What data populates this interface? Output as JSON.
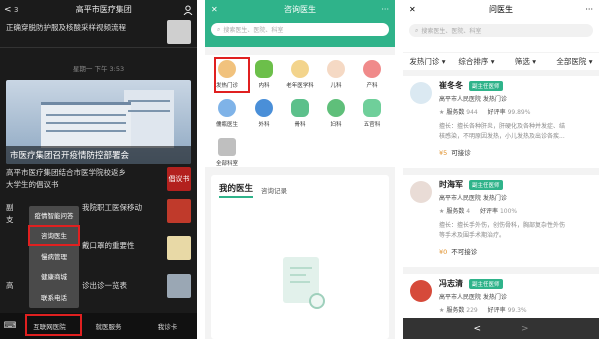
{
  "screen1": {
    "back": "<",
    "unread_badge": "3",
    "title": "高平市医疗集团",
    "feed_item_1": "正确穿脱防护服及核酸采样视频流程",
    "timestamp": "星期一 下午 3:53",
    "banner_caption": "市医疗集团召开疫情防控部署会",
    "feed_item_2_line1": "高平市医疗集团结合市医学院校返乡",
    "feed_item_2_line2": "大学生的倡议书",
    "proposal_thumb": "倡议书",
    "feed_item_3_left": "副",
    "feed_item_3_left2": "支",
    "feed_item_3": "我院职工医保移动",
    "feed_item_4": "戴口罩的重要性",
    "feed_item_5_left": "高",
    "feed_item_5": "诊出诊一览表",
    "popup_menu": [
      "疫情智能问答",
      "咨询医生",
      "慢病管理",
      "健康商城",
      "联系电话"
    ],
    "bottom_tabs": [
      "互联网医院",
      "就医服务",
      "我诊卡"
    ]
  },
  "screen2": {
    "title": "咨询医生",
    "close": "✕",
    "more": "···",
    "search_placeholder": "搜索医生、医院、科室",
    "departments": [
      "发热门诊",
      "内科",
      "老年医学科",
      "儿科",
      "产科",
      "儒瓶医生",
      "外科",
      "骨科",
      "妇科",
      "五官科",
      "全部科室"
    ],
    "tab_active": "我的医生",
    "tab_other": "咨询记录"
  },
  "screen3": {
    "title": "问医生",
    "close": "✕",
    "more": "···",
    "search_placeholder": "搜索医生、医院、科室",
    "filters": [
      "发热门诊 ▾",
      "综合排序 ▾",
      "筛选 ▾",
      "全部医院 ▾"
    ],
    "doctors": [
      {
        "name": "崔冬冬",
        "title": "副主任医师",
        "hospital": "高平市人民医院 发热门诊",
        "service_label": "服务数",
        "service_count": "944",
        "rating_label": "好评率",
        "rating": "99.89%",
        "bio1": "擅长：擅长各种肝炎，肝硬化及各种并发症、结",
        "bio2": "核感染，不明原因发热，小儿发热及出诊各疾...",
        "price": "¥5",
        "status": "可接诊"
      },
      {
        "name": "时海军",
        "title": "副主任医师",
        "hospital": "高平市人民医院 发热门诊",
        "service_label": "服务数",
        "service_count": "4",
        "rating_label": "好评率",
        "rating": "100%",
        "bio1": "擅长：擅长手外伤，创伤骨科，胸部复杂性外伤",
        "bio2": "等手术及围手术期治疗。",
        "price": "¥0",
        "status": "不可接诊"
      },
      {
        "name": "冯志清",
        "title": "副主任医师",
        "hospital": "高平市人民医院 发热门诊",
        "service_label": "服务数",
        "service_count": "229",
        "rating_label": "好评率",
        "rating": "99.3%"
      }
    ],
    "nav_prev": "<",
    "nav_next": ">"
  },
  "colors": {
    "green": "#2fb38a",
    "highlight_red": "#e02020",
    "price_orange": "#e0902a"
  }
}
